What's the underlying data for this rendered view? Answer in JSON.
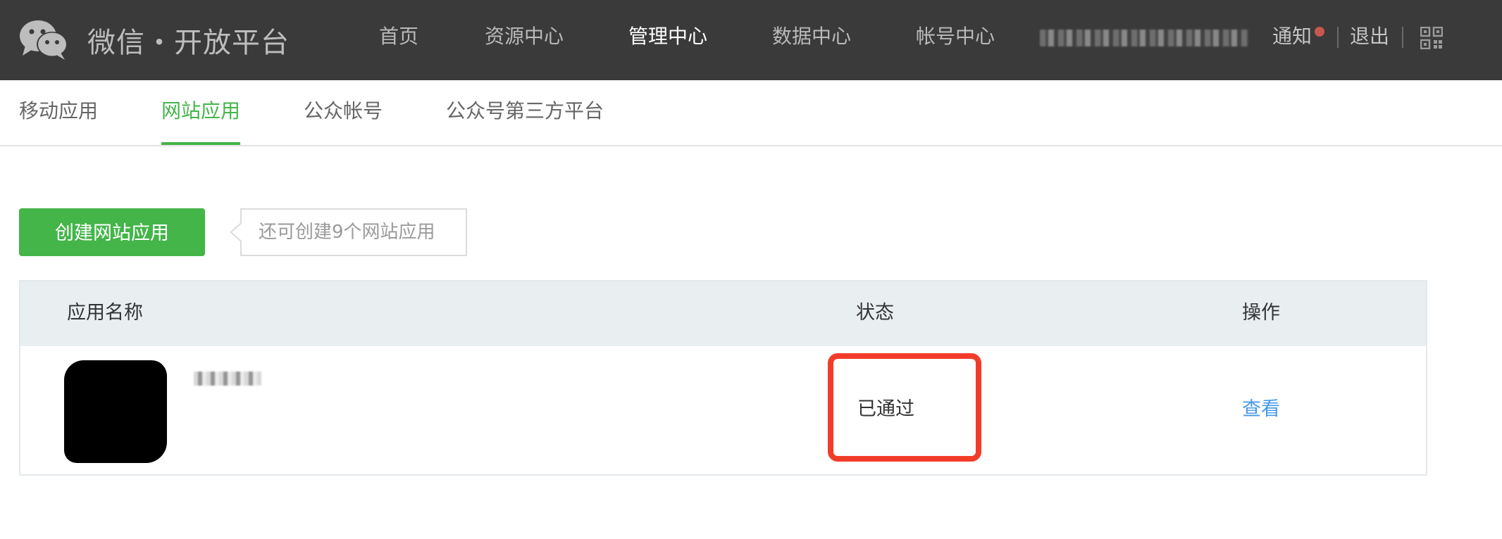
{
  "brand": {
    "title": "微信・开放平台",
    "logo_icon": "wechat-logo-icon"
  },
  "nav": {
    "home": "首页",
    "resources": "资源中心",
    "management": "管理中心",
    "data": "数据中心",
    "account": "帐号中心"
  },
  "user_links": {
    "notify": "通知",
    "logout": "退出",
    "qr_icon": "qr-code-icon"
  },
  "subtabs": {
    "mobile": "移动应用",
    "website": "网站应用",
    "official": "公众帐号",
    "third_party": "公众号第三方平台"
  },
  "actions": {
    "create_label": "创建网站应用",
    "tip": "还可创建9个网站应用"
  },
  "table": {
    "headers": {
      "name": "应用名称",
      "status": "状态",
      "operation": "操作"
    },
    "rows": [
      {
        "status": "已通过",
        "action": "查看"
      }
    ]
  },
  "colors": {
    "topbar": "#3a3a3a",
    "accent_green": "#44b549",
    "link_blue": "#459ae9",
    "highlight_red": "#f23c2a",
    "notify_dot": "#c8574f"
  }
}
